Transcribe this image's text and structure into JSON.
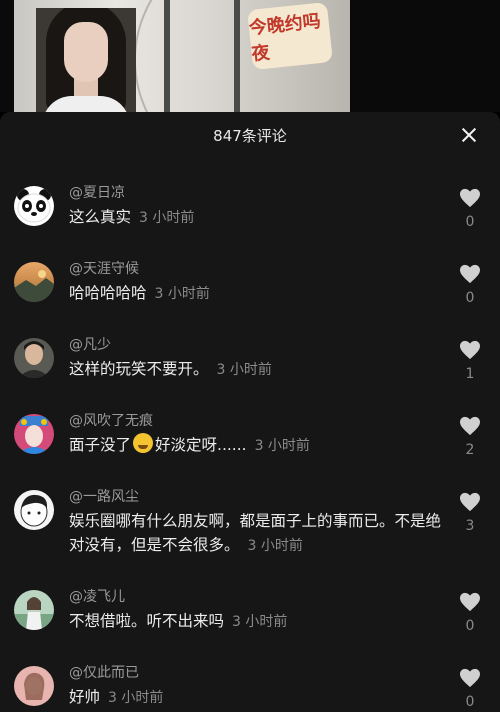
{
  "header": {
    "title": "847条评论"
  },
  "video": {
    "logo_text": "今晚约吗夜"
  },
  "comments": [
    {
      "user": "@夏日凉",
      "text": "这么真实",
      "time": "3 小时前",
      "likes": "0",
      "avatar_icon": "panda-avatar-icon",
      "avatar_color": "#ffffff"
    },
    {
      "user": "@天涯守候",
      "text": "哈哈哈哈哈",
      "time": "3 小时前",
      "likes": "0",
      "avatar_icon": "sunset-landscape-avatar-icon",
      "avatar_color": "#c98a4a"
    },
    {
      "user": "@凡少",
      "text": "这样的玩笑不要开。",
      "time": "3 小时前",
      "likes": "1",
      "avatar_icon": "man-portrait-avatar-icon",
      "avatar_color": "#5a5a54"
    },
    {
      "user": "@风吹了无痕",
      "text_before": "面子没了",
      "text_after": "好淡定呀......",
      "time": "3 小时前",
      "likes": "2",
      "avatar_icon": "opera-costume-avatar-icon",
      "avatar_color": "#d44b7a",
      "emoji_icon": "laughing-tears-emoji-icon"
    },
    {
      "user": "@一路风尘",
      "text": "娱乐圈哪有什么朋友啊，都是面子上的事而已。不是绝对没有，但是不会很多。",
      "time": "3 小时前",
      "likes": "3",
      "avatar_icon": "cartoon-boy-avatar-icon",
      "avatar_color": "#f5f5f5"
    },
    {
      "user": "@凌飞儿",
      "text": "不想借啦。听不出来吗",
      "time": "3 小时前",
      "likes": "0",
      "avatar_icon": "girl-outdoor-avatar-icon",
      "avatar_color": "#b9d4c0"
    },
    {
      "user": "@仅此而已",
      "text": "好帅",
      "time": "3 小时前",
      "likes": "0",
      "avatar_icon": "girl-pink-avatar-icon",
      "avatar_color": "#e8b4b0"
    }
  ],
  "colors": {
    "sheet_bg": "#161616",
    "username": "#9a9a9a",
    "time": "#8a8a8a",
    "heart": "#d0d0d0"
  }
}
